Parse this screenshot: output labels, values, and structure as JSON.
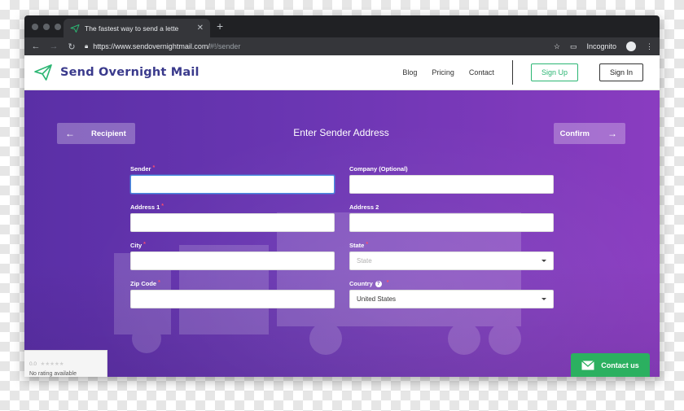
{
  "browser": {
    "tab_title": "The fastest way to send a lette",
    "url_host": "https://www.sendovernightmail.com/",
    "url_path": "#!/sender",
    "incognito_label": "Incognito"
  },
  "site": {
    "brand": "Send Overnight Mail",
    "nav": {
      "blog": "Blog",
      "pricing": "Pricing",
      "contact": "Contact"
    },
    "signup_label": "Sign Up",
    "signin_label": "Sign In"
  },
  "steps": {
    "back_label": "Recipient",
    "title": "Enter Sender Address",
    "next_label": "Confirm"
  },
  "form": {
    "sender": {
      "label": "Sender",
      "required": "*",
      "value": ""
    },
    "company": {
      "label": "Company (Optional)",
      "value": ""
    },
    "address1": {
      "label": "Address 1",
      "required": "*",
      "value": ""
    },
    "address2": {
      "label": "Address 2",
      "value": ""
    },
    "city": {
      "label": "City",
      "required": "*",
      "value": ""
    },
    "state": {
      "label": "State",
      "required": "*",
      "placeholder": "State"
    },
    "zip": {
      "label": "Zip Code",
      "required": "*",
      "value": ""
    },
    "country": {
      "label": "Country",
      "help": "?",
      "required": "*",
      "value": "United States"
    }
  },
  "rating_widget": {
    "score": "0.0",
    "stars": "★★★★★",
    "text": "No rating available"
  },
  "contact_us": {
    "label": "Contact us"
  },
  "colors": {
    "brand_green": "#2bb673",
    "brand_navy": "#3a3a8c",
    "hero_start": "#5a2fa6",
    "hero_end": "#8a3cc0"
  }
}
